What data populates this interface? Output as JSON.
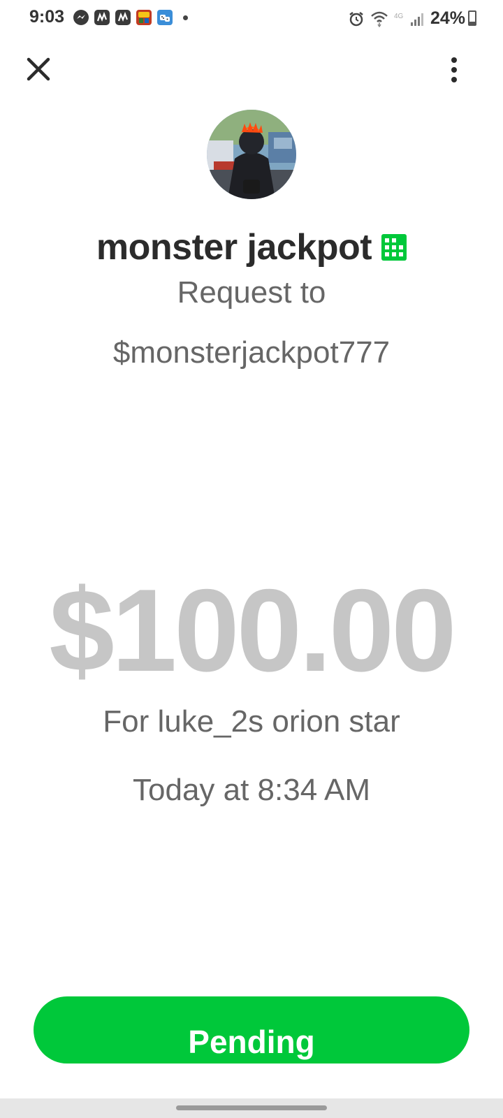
{
  "status_bar": {
    "time": "9:03",
    "battery_percent": "24%",
    "battery_level": 0.24,
    "network": "4G",
    "notification_icons": [
      "messenger-icon",
      "app-n-icon",
      "app-n-icon",
      "game-icon",
      "dice-game-icon"
    ],
    "system_icons": [
      "alarm-icon",
      "wifi-icon",
      "signal-icon"
    ]
  },
  "header": {
    "close_icon": "close-icon",
    "more_icon": "more-vertical-icon"
  },
  "profile": {
    "name": "monster jackpot",
    "badge_icon": "business-building-icon",
    "badge_color": "#00c83a",
    "subtitle": "Request to",
    "cashtag": "$monsterjackpot777"
  },
  "transaction": {
    "amount": "$100.00",
    "note": "For luke_2s orion star",
    "timestamp": "Today at 8:34 AM"
  },
  "action": {
    "status_label": "Pending",
    "color": "#00c83a"
  }
}
